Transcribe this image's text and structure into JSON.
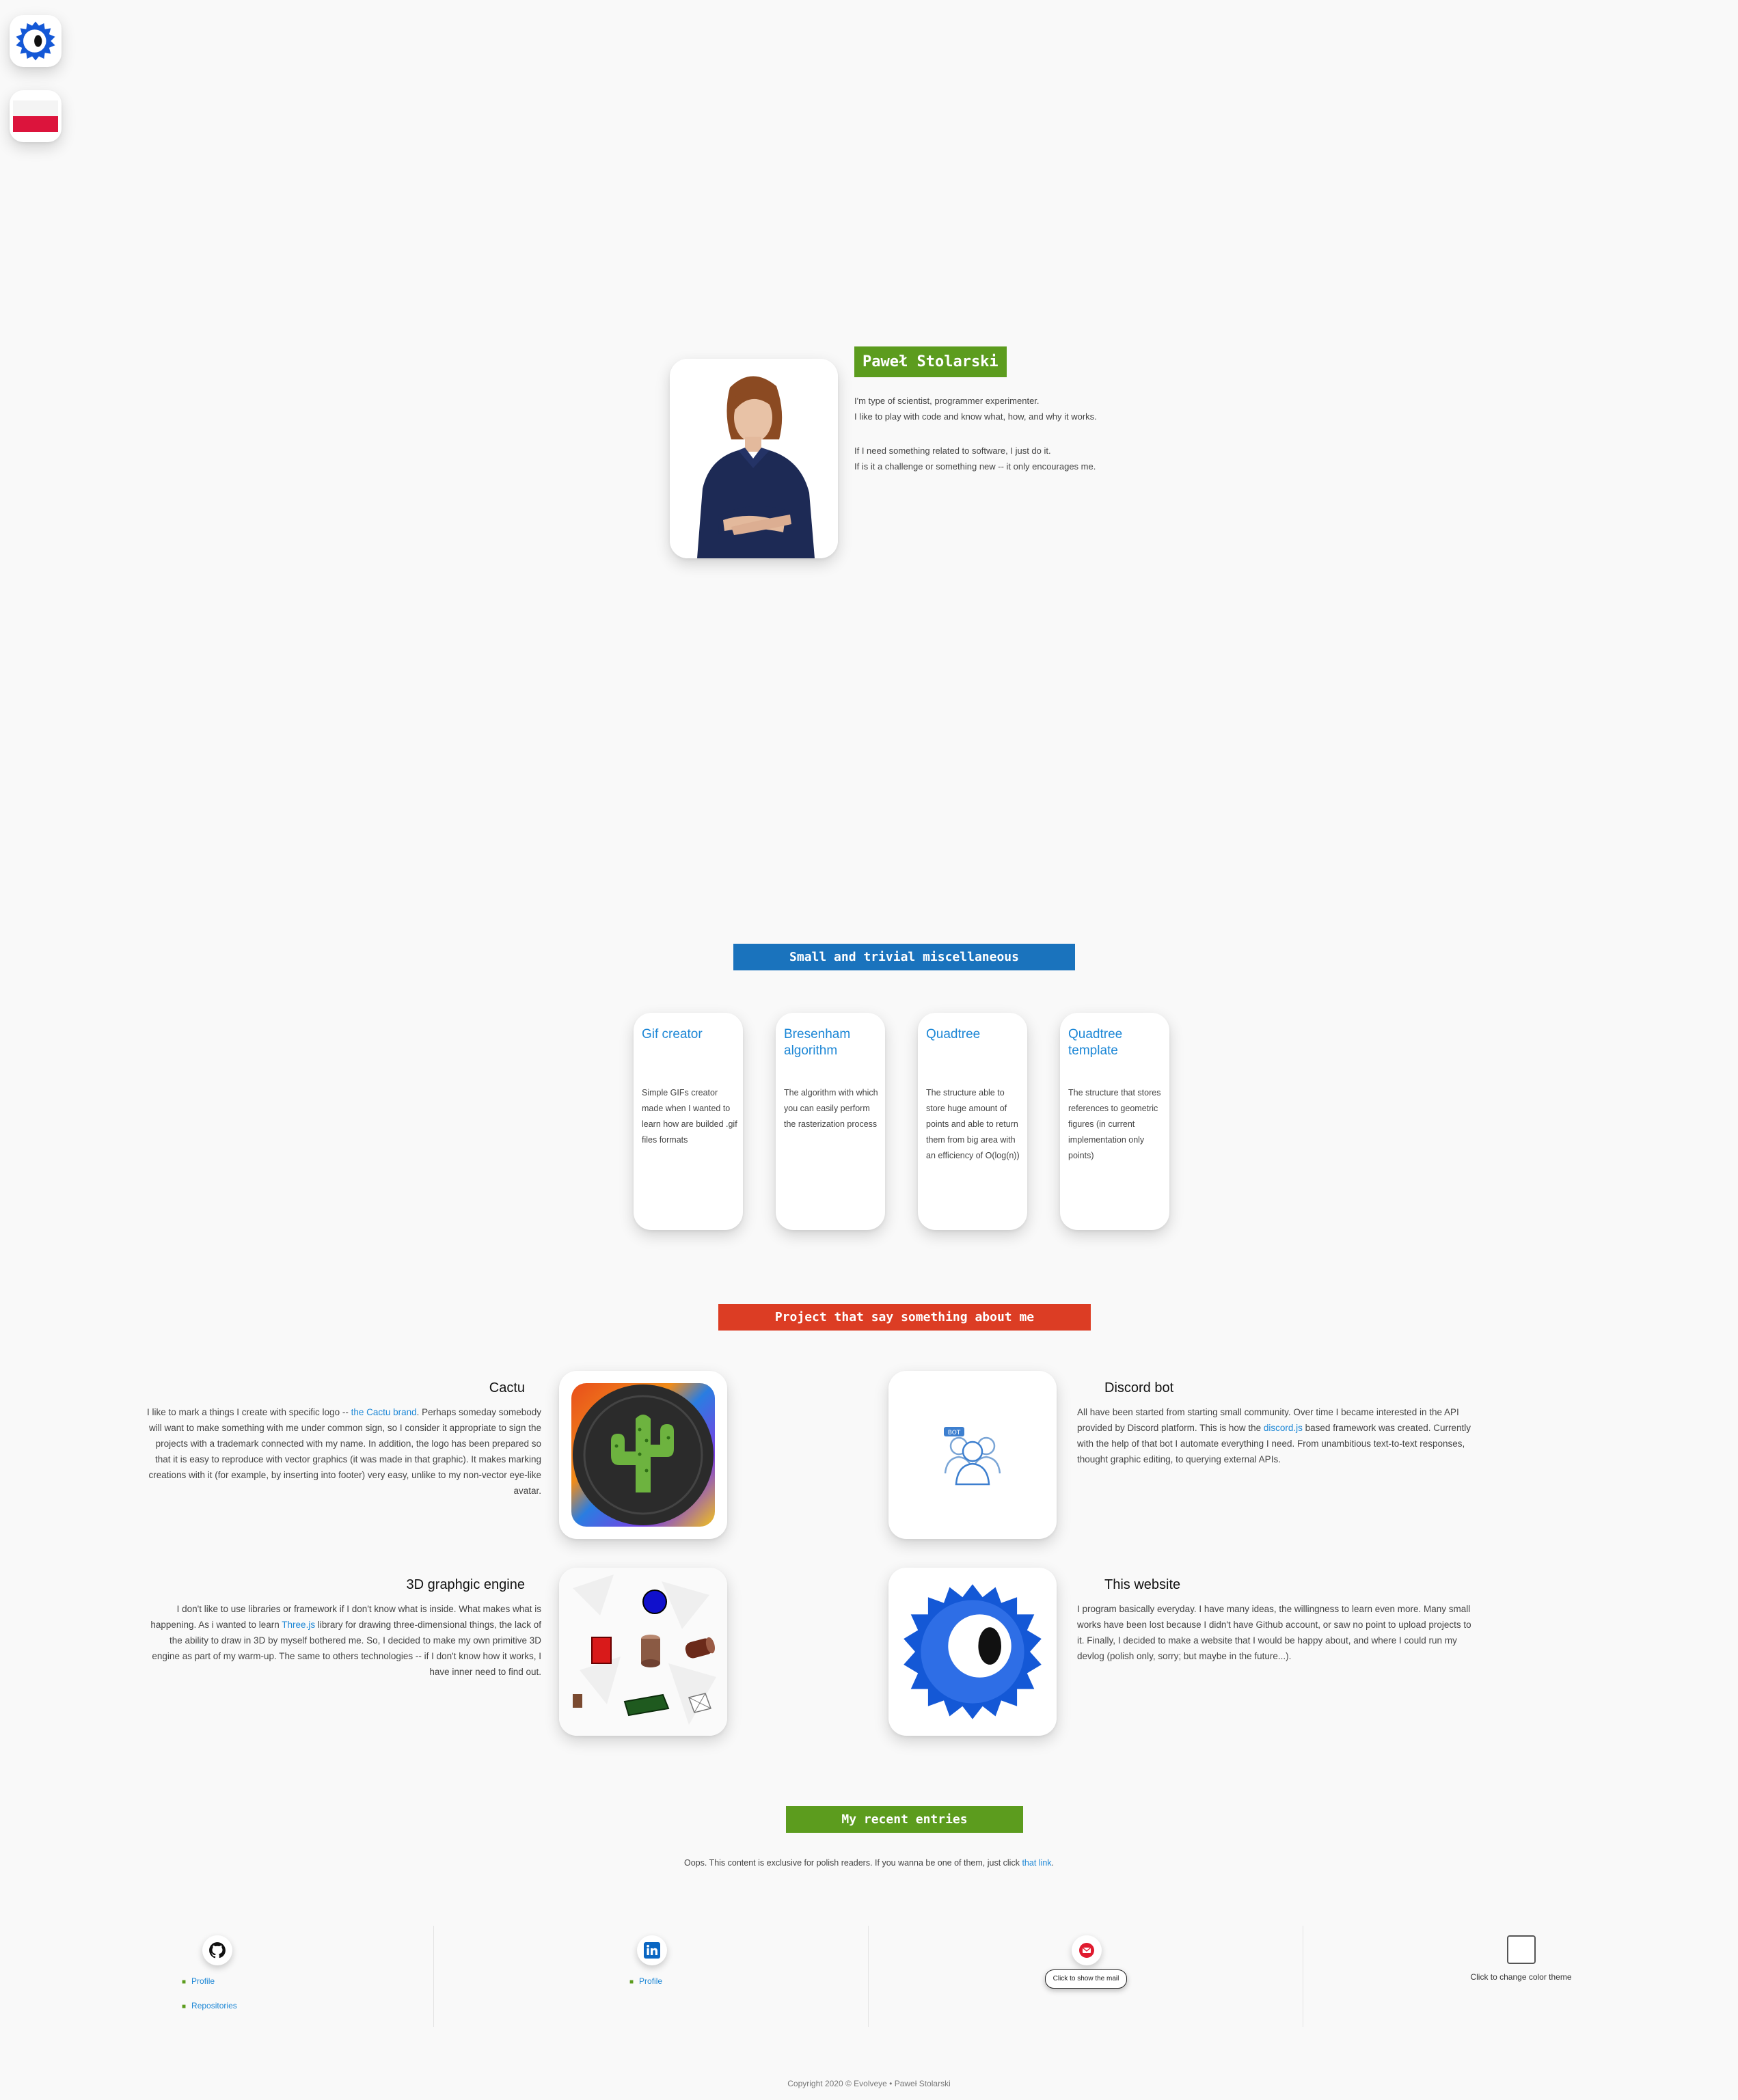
{
  "nav": {
    "logo_icon": "evolveye-eye-icon",
    "language_icon": "polish-flag-icon"
  },
  "hero": {
    "name": "Paweł Stolarski",
    "photo_icon": "portrait-photo",
    "para1_line1": "I'm type of scientist, programmer experimenter.",
    "para1_line2": "I like to play with code and know what, how, and why it works.",
    "para2_line1": "If I need something related to software, I just do it.",
    "para2_line2": "If is it a challenge or something new -- it only encourages me."
  },
  "misc": {
    "heading": "Small and trivial miscellaneous",
    "heading_color": "#1a73bd",
    "items": [
      {
        "title": "Gif creator",
        "desc": "Simple GIFs creator made when I wanted to learn how are builded .gif files formats"
      },
      {
        "title": "Bresenham algorithm",
        "desc": "The algorithm with which you can easily perform the rasterization process"
      },
      {
        "title": "Quadtree",
        "desc": "The structure able to store huge amount of points and able to return them from big area with an efficiency of O(log(n))"
      },
      {
        "title": "Quadtree template",
        "desc": "The structure that stores references to geometric figures (in current implementation only points)"
      }
    ]
  },
  "projects": {
    "heading": "Project that say something about me",
    "heading_color": "#dc3d24",
    "cactu": {
      "title": "Cactu",
      "text_before": "I like to mark a things I create with specific logo -- ",
      "link": "the Cactu brand",
      "text_after": ". Perhaps someday somebody will want to make something with me under common sign, so I consider it appropriate to sign the projects with a trademark connected with my name. In addition, the logo has been prepared so that it is easy to reproduce with vector graphics (it was made in that graphic). It makes marking creations with it (for example, by inserting into footer) very easy, unlike to my non-vector eye-like avatar.",
      "image_icon": "cactus-logo-icon"
    },
    "discord": {
      "title": "Discord bot",
      "text_before": "All have been started from starting small community. Over time I became interested in the API provided by Discord platform. This is how the ",
      "link": "discord.js",
      "text_after": " based framework was created. Currently with the help of that bot I automate everything I need. From unambitious text-to-text responses, thought graphic editing, to querying external APIs.",
      "image_icon": "bot-users-icon",
      "badge": "BOT"
    },
    "engine": {
      "title": "3D graphgic engine",
      "text_before": "I don't like to use libraries or framework if I don't know what is inside. What makes what is happening. As i wanted to learn ",
      "link": "Three.js",
      "text_after": " library for drawing three-dimensional things, the lack of the ability to draw in 3D by myself bothered me. So, I decided to make my own primitive 3D engine as part of my warm-up. The same to others technologies -- if I don't know how it works, I have inner need to find out.",
      "image_icon": "3d-primitives-icon"
    },
    "website": {
      "title": "This website",
      "text": "I program basically everyday. I have many ideas, the willingness to learn even more. Many small works have been lost because I didn't have Github account, or saw no point to upload projects to it. Finally, I decided to make a website that I would be happy about, and where I could run my devlog (polish only, sorry; but maybe in the future...).",
      "image_icon": "evolveye-eye-icon"
    }
  },
  "entries": {
    "heading": "My recent entries",
    "heading_color": "#5c9c1e",
    "text_before": "Oops. This content is exclusive for polish readers. If you wanna be one of them, just click ",
    "link": "that link",
    "text_after": "."
  },
  "footer": {
    "github": {
      "icon": "github-icon",
      "links": [
        "Profile",
        "Repositories"
      ]
    },
    "linkedin": {
      "icon": "linkedin-icon",
      "links": [
        "Profile"
      ]
    },
    "mail": {
      "icon": "mail-icon",
      "button": "Click to show the mail"
    },
    "theme": {
      "icon": "theme-square-icon",
      "label": "Click to change color theme"
    },
    "copyright": "Copyright 2020 © Evolveye • Paweł Stolarski"
  }
}
